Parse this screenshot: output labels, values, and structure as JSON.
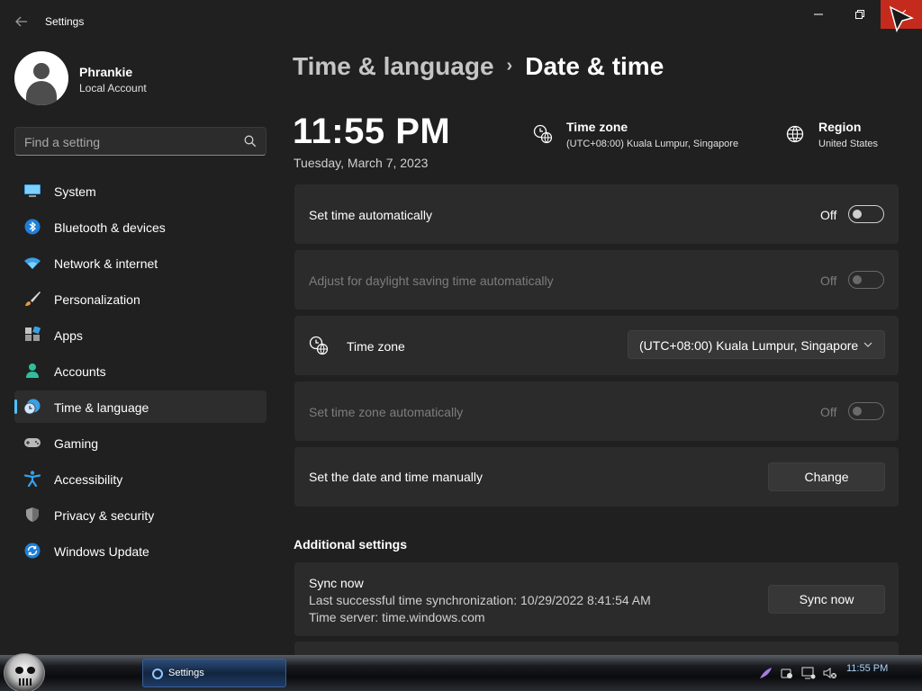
{
  "window": {
    "title": "Settings",
    "back_icon": "back-arrow-icon"
  },
  "profile": {
    "name": "Phrankie",
    "account_type": "Local Account"
  },
  "search": {
    "placeholder": "Find a setting"
  },
  "sidebar": {
    "items": [
      {
        "label": "System",
        "icon": "system-icon"
      },
      {
        "label": "Bluetooth & devices",
        "icon": "bluetooth-icon"
      },
      {
        "label": "Network & internet",
        "icon": "network-icon"
      },
      {
        "label": "Personalization",
        "icon": "brush-icon"
      },
      {
        "label": "Apps",
        "icon": "apps-icon"
      },
      {
        "label": "Accounts",
        "icon": "accounts-icon"
      },
      {
        "label": "Time & language",
        "icon": "clock-globe-icon",
        "active": true
      },
      {
        "label": "Gaming",
        "icon": "gamepad-icon"
      },
      {
        "label": "Accessibility",
        "icon": "accessibility-icon"
      },
      {
        "label": "Privacy & security",
        "icon": "shield-icon"
      },
      {
        "label": "Windows Update",
        "icon": "update-icon"
      }
    ]
  },
  "breadcrumb": {
    "parent": "Time & language",
    "separator": "›",
    "current": "Date & time"
  },
  "clock": {
    "time": "11:55 PM",
    "date": "Tuesday, March 7, 2023"
  },
  "info": {
    "timezone_title": "Time zone",
    "timezone_value": "(UTC+08:00) Kuala Lumpur, Singapore",
    "region_title": "Region",
    "region_value": "United States"
  },
  "settings": {
    "set_time_auto": {
      "label": "Set time automatically",
      "state": "Off"
    },
    "daylight": {
      "label": "Adjust for daylight saving time automatically",
      "state": "Off"
    },
    "timezone": {
      "label": "Time zone",
      "selected": "(UTC+08:00) Kuala Lumpur, Singapore"
    },
    "timezone_auto": {
      "label": "Set time zone automatically",
      "state": "Off"
    },
    "manual": {
      "label": "Set the date and time manually",
      "button": "Change"
    }
  },
  "additional": {
    "title": "Additional settings",
    "sync_title": "Sync now",
    "sync_last": "Last successful time synchronization: 10/29/2022 8:41:54 AM",
    "sync_server": "Time server: time.windows.com",
    "sync_button": "Sync now"
  },
  "taskbar": {
    "app_label": "Settings",
    "clock": "11:55 PM"
  },
  "colors": {
    "accent": "#4cc2ff",
    "close_button": "#c42b1c",
    "background": "#202020",
    "card": "#2b2b2b"
  }
}
